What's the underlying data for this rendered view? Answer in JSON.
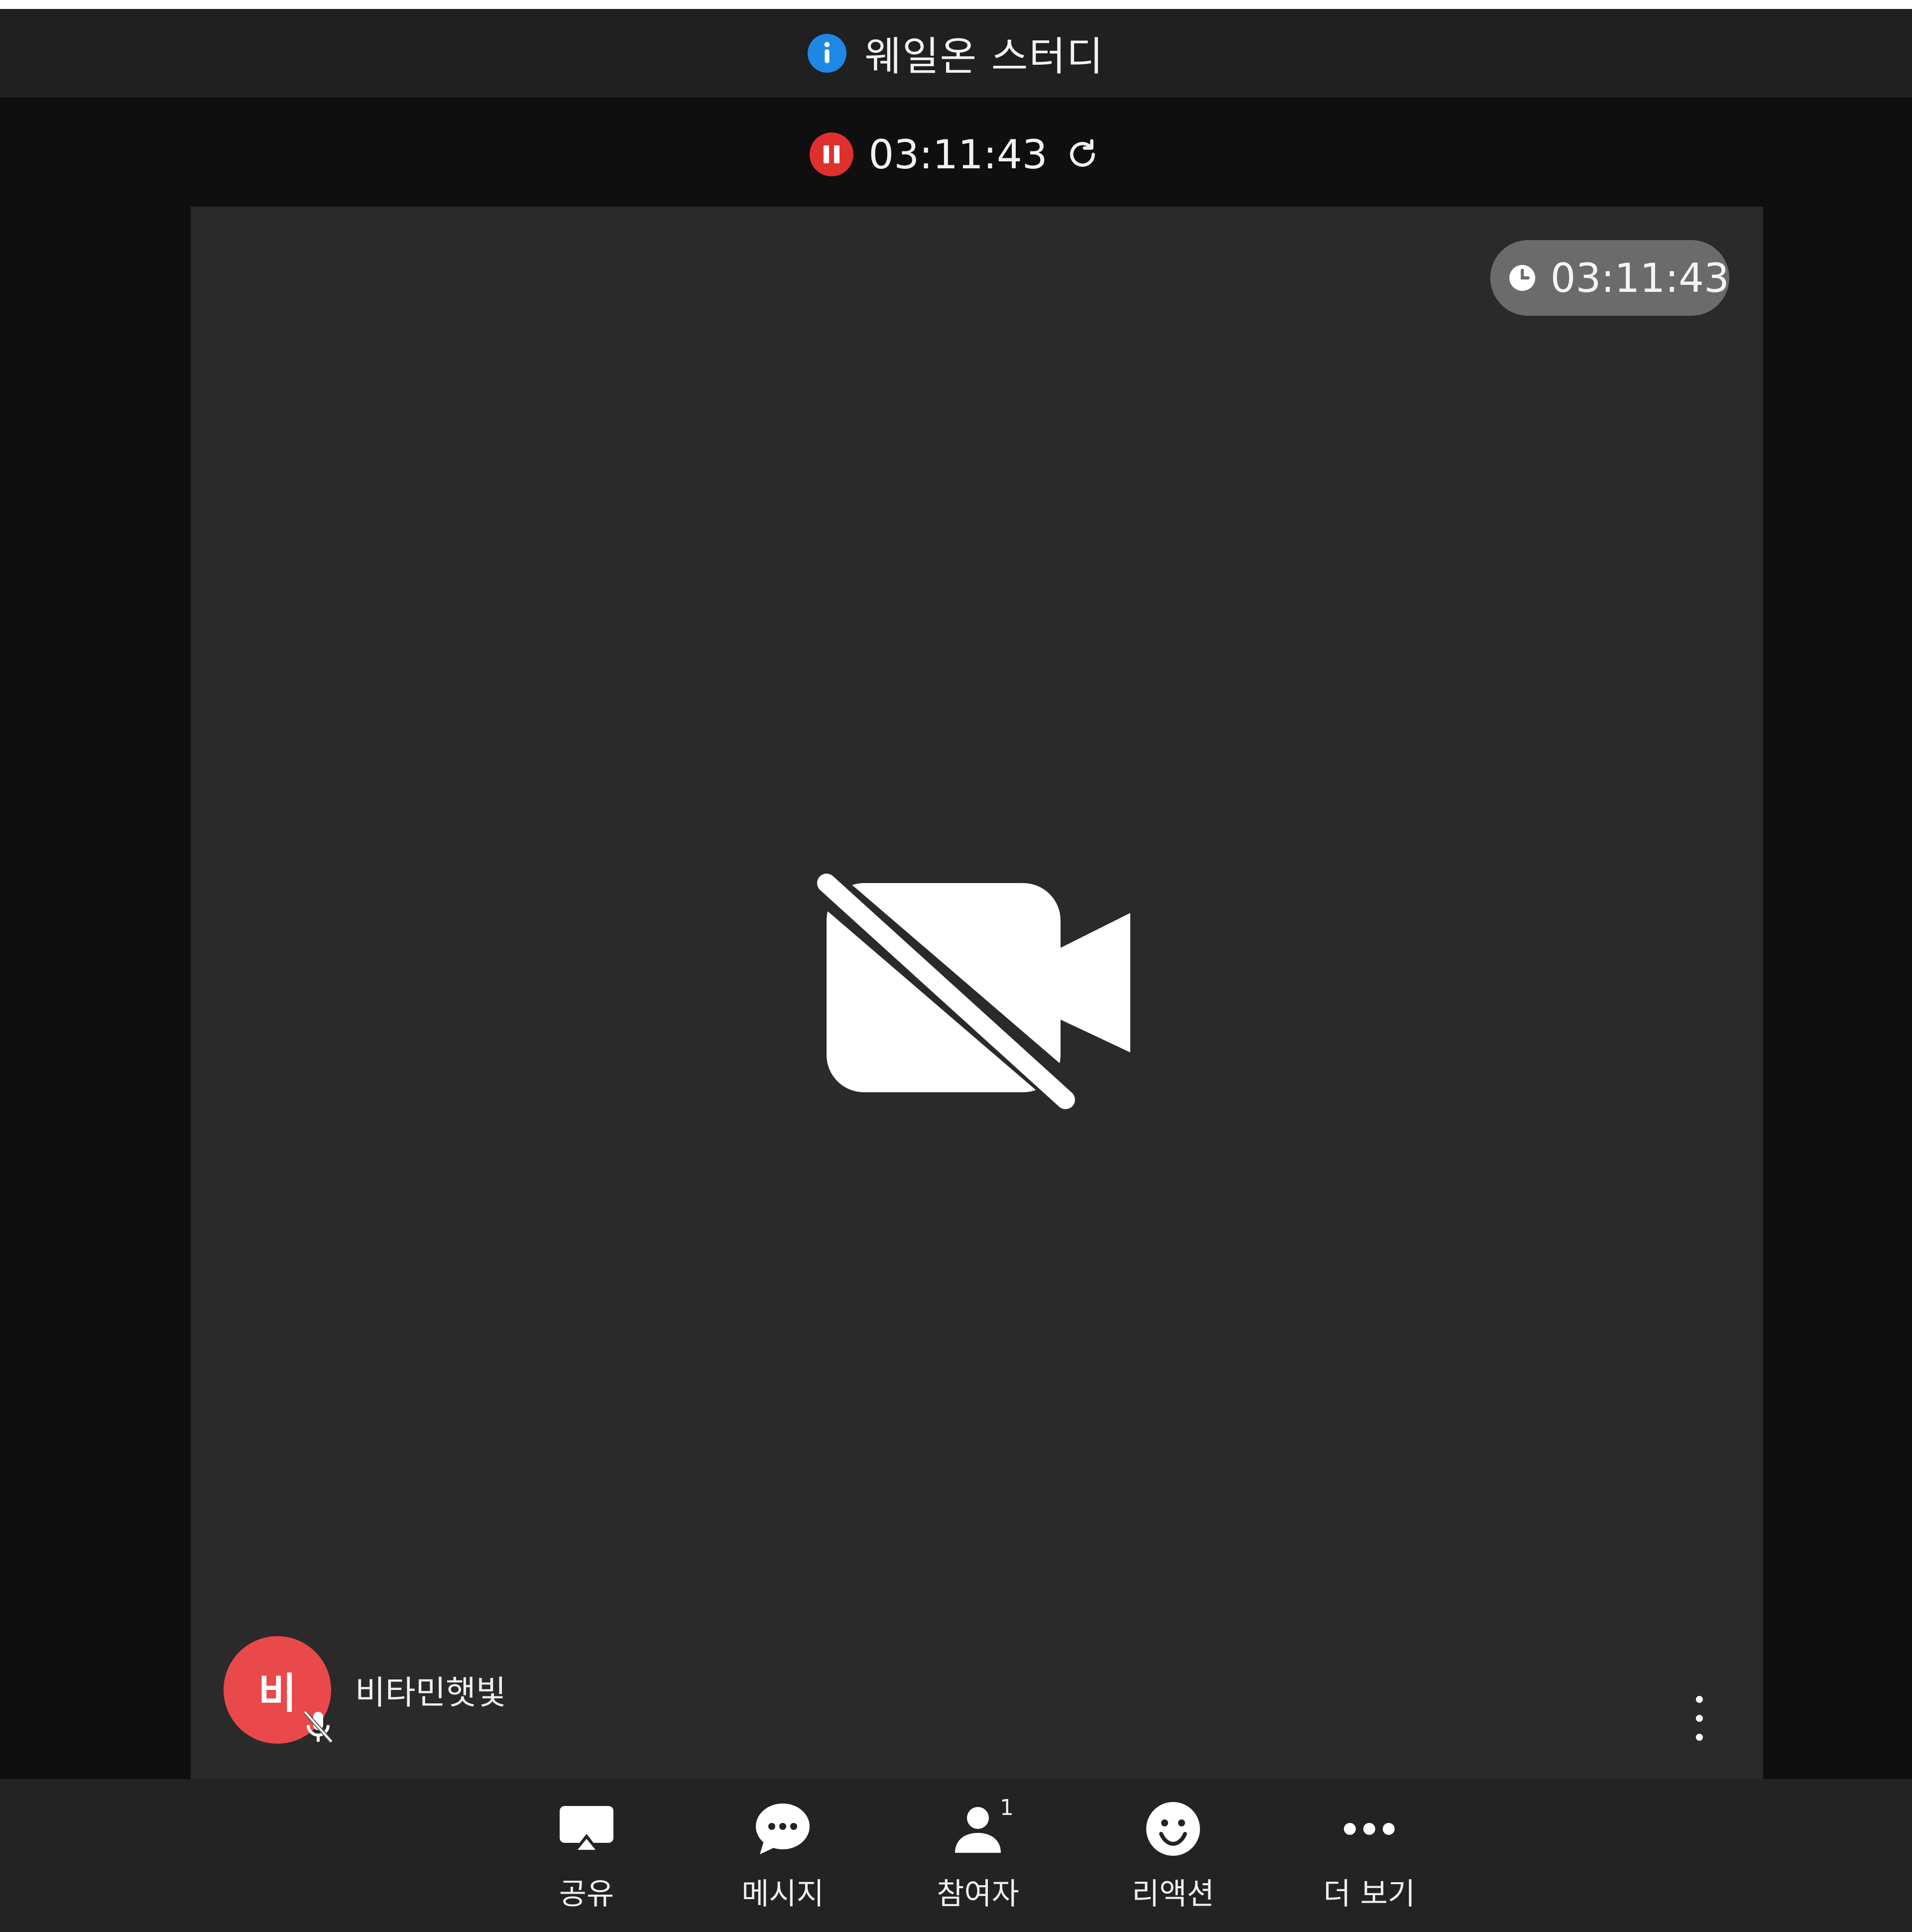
{
  "meeting": {
    "title": "웨일온 스터디",
    "recording_time": "03:11:43",
    "elapsed_time": "03:11:43"
  },
  "participant": {
    "avatar_initial": "비",
    "name": "비타민햇빛",
    "mic_muted": true,
    "camera_off": true
  },
  "toolbar": {
    "share_label": "공유",
    "message_label": "메시지",
    "participants_label": "참여자",
    "participants_count": "1",
    "reaction_label": "리액션",
    "more_label": "더 보기"
  },
  "colors": {
    "info_blue": "#1e88e5",
    "record_red": "#e0302d",
    "avatar_red": "#e9494a",
    "panel_bg": "#2a2a2a"
  }
}
